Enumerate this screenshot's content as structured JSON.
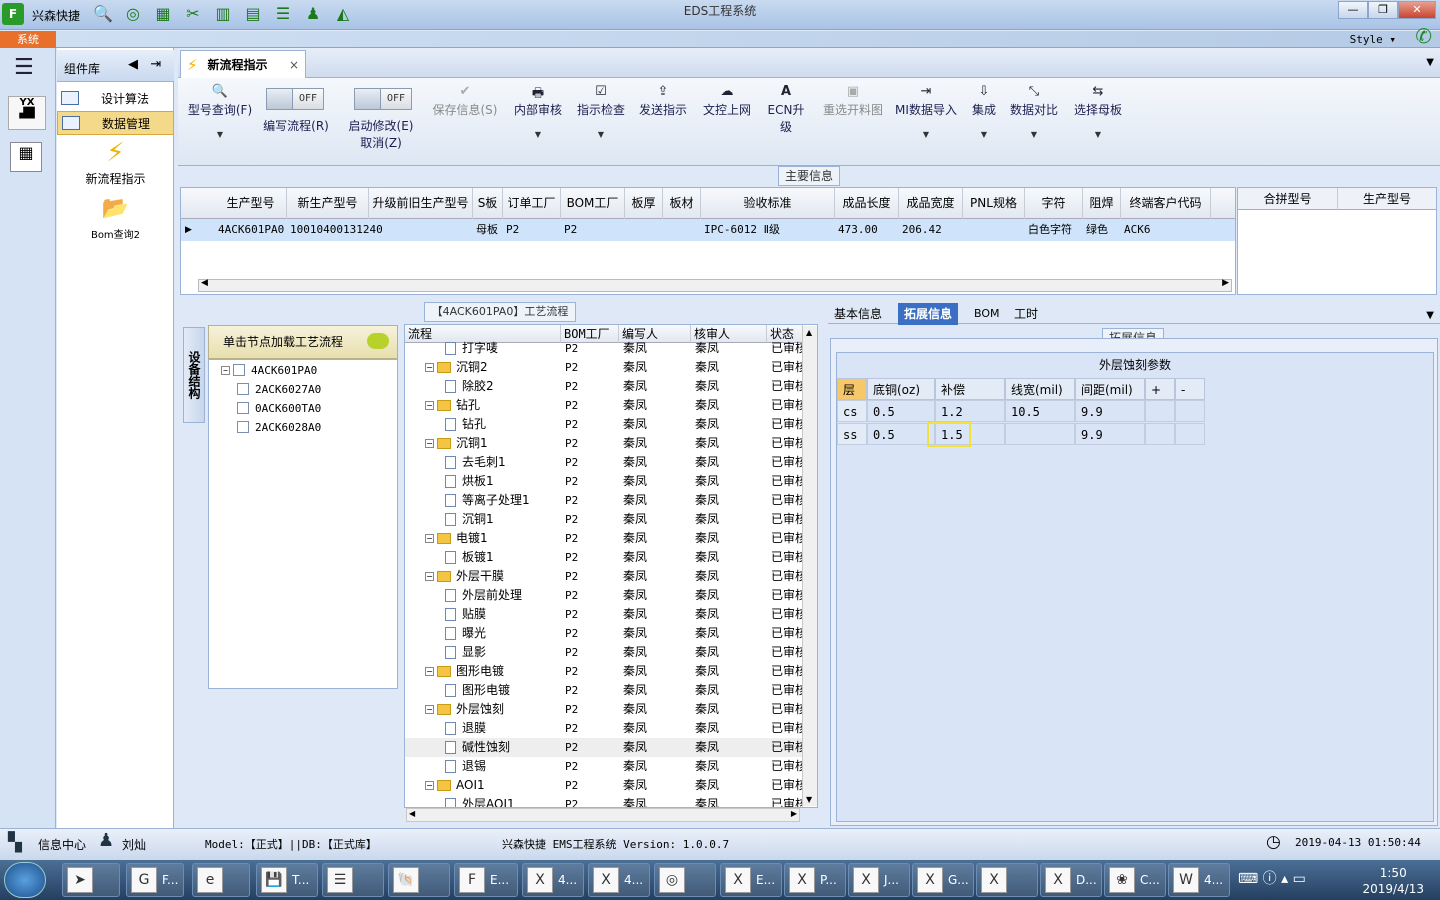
{
  "titlebar": {
    "app_icon": "F",
    "app_name": "兴森快捷",
    "window_title": "EDS工程系统",
    "min": "—",
    "restore": "❐",
    "close": "✕",
    "quick_icons": [
      "search-icon",
      "globe-icon",
      "grid-icon",
      "scissors-icon",
      "film-icon",
      "layers-icon",
      "list-icon",
      "user-icon",
      "chart-icon"
    ]
  },
  "row2": {
    "system_tab": "系统",
    "style_label": "Style ▾"
  },
  "component": {
    "title": "组件库",
    "items": [
      {
        "label": "设计算法"
      },
      {
        "label": "数据管理"
      }
    ],
    "big_items": [
      {
        "label": "新流程指示"
      },
      {
        "label": "Bom查询2"
      }
    ]
  },
  "doc_tab": {
    "label": "新流程指示",
    "close": "×"
  },
  "ribbon": {
    "toggle_off": "OFF",
    "buttons": [
      {
        "label": "型号查询(F)",
        "icon": "🔍"
      },
      {
        "label": "编写流程(R)"
      },
      {
        "label": "启动修改(E)",
        "sub": "取消(Z)"
      },
      {
        "label": "保存信息(S)",
        "icon": "✔"
      },
      {
        "label": "内部审核",
        "icon": "🖶"
      },
      {
        "label": "指示检查",
        "icon": "☑"
      },
      {
        "label": "发送指示",
        "icon": "⇪"
      },
      {
        "label": "文控上网",
        "icon": "☁"
      },
      {
        "label": "ECN升级",
        "icon": "A"
      },
      {
        "label": "重选开料图",
        "icon": "▣"
      },
      {
        "label": "MI数据导入",
        "icon": "⇥"
      },
      {
        "label": "集成",
        "icon": "⇩"
      },
      {
        "label": "数据对比",
        "icon": "⤡"
      },
      {
        "label": "选择母板",
        "icon": "⇆"
      }
    ]
  },
  "main_info": {
    "title": "主要信息",
    "columns": [
      "生产型号",
      "新生产型号",
      "升级前旧生产型号",
      "S板",
      "订单工厂",
      "BOM工厂",
      "板厚",
      "板材",
      "验收标准",
      "成品长度",
      "成品宽度",
      "PNL规格",
      "字符",
      "阻焊",
      "终端客户代码"
    ],
    "row": [
      "4ACK601PA0",
      "10010400131240",
      "",
      "母板",
      "P2",
      "P2",
      "",
      "",
      "IPC-6012 Ⅱ级",
      "473.00",
      "206.42",
      "",
      "白色字符",
      "绿色",
      "ACK6"
    ],
    "side_columns": [
      "合拼型号",
      "生产型号"
    ]
  },
  "process": {
    "title": "【4ACK601PA0】工艺流程",
    "vertical_tab": "设备结构",
    "tree_header": "单击节点加载工艺流程",
    "tree": [
      "4ACK601PA0",
      "2ACK6027A0",
      "0ACK600TA0",
      "2ACK6028A0"
    ],
    "columns": [
      "流程",
      "BOM工厂",
      "编写人",
      "核审人",
      "状态"
    ],
    "rows": [
      {
        "name": "打字唛",
        "level": 1,
        "type": "doc",
        "bom": "P2",
        "writer": "秦凤",
        "reviewer": "秦凤",
        "status": "已审核"
      },
      {
        "name": "沉铜2",
        "level": 0,
        "type": "folder",
        "bom": "P2",
        "writer": "秦凤",
        "reviewer": "秦凤",
        "status": "已审核"
      },
      {
        "name": "除胶2",
        "level": 1,
        "type": "doc",
        "bom": "P2",
        "writer": "秦凤",
        "reviewer": "秦凤",
        "status": "已审核"
      },
      {
        "name": "钻孔",
        "level": 0,
        "type": "folder",
        "bom": "P2",
        "writer": "秦凤",
        "reviewer": "秦凤",
        "status": "已审核"
      },
      {
        "name": "钻孔",
        "level": 1,
        "type": "doc",
        "bom": "P2",
        "writer": "秦凤",
        "reviewer": "秦凤",
        "status": "已审核"
      },
      {
        "name": "沉铜1",
        "level": 0,
        "type": "folder",
        "bom": "P2",
        "writer": "秦凤",
        "reviewer": "秦凤",
        "status": "已审核"
      },
      {
        "name": "去毛刺1",
        "level": 1,
        "type": "doc",
        "bom": "P2",
        "writer": "秦凤",
        "reviewer": "秦凤",
        "status": "已审核"
      },
      {
        "name": "烘板1",
        "level": 1,
        "type": "doc",
        "bom": "P2",
        "writer": "秦凤",
        "reviewer": "秦凤",
        "status": "已审核"
      },
      {
        "name": "等离子处理1",
        "level": 1,
        "type": "doc",
        "bom": "P2",
        "writer": "秦凤",
        "reviewer": "秦凤",
        "status": "已审核"
      },
      {
        "name": "沉铜1",
        "level": 1,
        "type": "doc",
        "bom": "P2",
        "writer": "秦凤",
        "reviewer": "秦凤",
        "status": "已审核"
      },
      {
        "name": "电镀1",
        "level": 0,
        "type": "folder",
        "bom": "P2",
        "writer": "秦凤",
        "reviewer": "秦凤",
        "status": "已审核"
      },
      {
        "name": "板镀1",
        "level": 1,
        "type": "doc",
        "bom": "P2",
        "writer": "秦凤",
        "reviewer": "秦凤",
        "status": "已审核"
      },
      {
        "name": "外层干膜",
        "level": 0,
        "type": "folder",
        "bom": "P2",
        "writer": "秦凤",
        "reviewer": "秦凤",
        "status": "已审核"
      },
      {
        "name": "外层前处理",
        "level": 1,
        "type": "doc",
        "bom": "P2",
        "writer": "秦凤",
        "reviewer": "秦凤",
        "status": "已审核"
      },
      {
        "name": "贴膜",
        "level": 1,
        "type": "doc",
        "bom": "P2",
        "writer": "秦凤",
        "reviewer": "秦凤",
        "status": "已审核"
      },
      {
        "name": "曝光",
        "level": 1,
        "type": "doc",
        "bom": "P2",
        "writer": "秦凤",
        "reviewer": "秦凤",
        "status": "已审核"
      },
      {
        "name": "显影",
        "level": 1,
        "type": "doc",
        "bom": "P2",
        "writer": "秦凤",
        "reviewer": "秦凤",
        "status": "已审核"
      },
      {
        "name": "图形电镀",
        "level": 0,
        "type": "folder",
        "bom": "P2",
        "writer": "秦凤",
        "reviewer": "秦凤",
        "status": "已审核"
      },
      {
        "name": "图形电镀",
        "level": 1,
        "type": "doc",
        "bom": "P2",
        "writer": "秦凤",
        "reviewer": "秦凤",
        "status": "已审核"
      },
      {
        "name": "外层蚀刻",
        "level": 0,
        "type": "folder",
        "bom": "P2",
        "writer": "秦凤",
        "reviewer": "秦凤",
        "status": "已审核"
      },
      {
        "name": "退膜",
        "level": 1,
        "type": "doc",
        "bom": "P2",
        "writer": "秦凤",
        "reviewer": "秦凤",
        "status": "已审核"
      },
      {
        "name": "碱性蚀刻",
        "level": 1,
        "type": "doc",
        "bom": "P2",
        "writer": "秦凤",
        "reviewer": "秦凤",
        "status": "已审核",
        "selected": true
      },
      {
        "name": "退锡",
        "level": 1,
        "type": "doc",
        "bom": "P2",
        "writer": "秦凤",
        "reviewer": "秦凤",
        "status": "已审核"
      },
      {
        "name": "AOI1",
        "level": 0,
        "type": "folder",
        "bom": "P2",
        "writer": "秦凤",
        "reviewer": "秦凤",
        "status": "已审核"
      },
      {
        "name": "外层AOI1",
        "level": 1,
        "type": "doc",
        "bom": "P2",
        "writer": "秦凤",
        "reviewer": "秦凤",
        "status": "已审核"
      }
    ]
  },
  "right": {
    "tabs": [
      "基本信息",
      "拓展信息",
      "BOM",
      "工时"
    ],
    "section_title": "拓展信息",
    "table_title": "外层蚀刻参数",
    "columns": [
      "层",
      "底铜(oz)",
      "补偿",
      "线宽(mil)",
      "间距(mil)",
      "+",
      "-"
    ],
    "rows": [
      [
        "cs",
        "0.5",
        "1.2",
        "10.5",
        "9.9",
        "",
        ""
      ],
      [
        "ss",
        "0.5",
        "1.5",
        "",
        "9.9",
        "",
        ""
      ]
    ]
  },
  "status": {
    "info": "信息中心",
    "user": "刘灿",
    "model": "Model:【正式】||DB:【正式库】",
    "version": "兴森快捷 EMS工程系统 Version: 1.0.0.7",
    "datetime": "2019-04-13 01:50:44"
  },
  "taskbar": {
    "buttons": [
      {
        "label": "",
        "glyph": "➤"
      },
      {
        "label": "F...",
        "glyph": "G"
      },
      {
        "label": "",
        "glyph": "e"
      },
      {
        "label": "T...",
        "glyph": "💾"
      },
      {
        "label": "",
        "glyph": "☰"
      },
      {
        "label": "",
        "glyph": "🐚"
      },
      {
        "label": "E...",
        "glyph": "F"
      },
      {
        "label": "4...",
        "glyph": "X"
      },
      {
        "label": "4...",
        "glyph": "X"
      },
      {
        "label": "",
        "glyph": "◎"
      },
      {
        "label": "E...",
        "glyph": "X"
      },
      {
        "label": "P...",
        "glyph": "X"
      },
      {
        "label": "J...",
        "glyph": "X"
      },
      {
        "label": "G...",
        "glyph": "X"
      },
      {
        "label": "",
        "glyph": "X"
      },
      {
        "label": "D...",
        "glyph": "X"
      },
      {
        "label": "C...",
        "glyph": "❀"
      },
      {
        "label": "4...",
        "glyph": "W"
      }
    ],
    "time": "1:50",
    "date": "2019/4/13"
  }
}
